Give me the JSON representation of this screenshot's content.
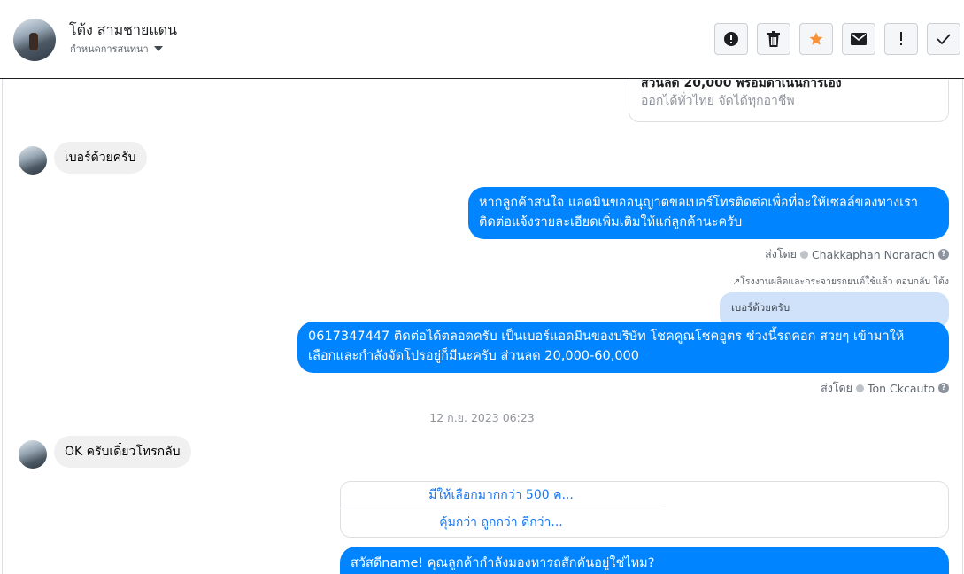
{
  "header": {
    "name": "โต้ง สามชายแดน",
    "subtitle": "กำหนดการสนทนา"
  },
  "toolbar": {
    "buttons": [
      "spam-alert-icon",
      "trash-icon",
      "star-icon",
      "envelope-icon",
      "exclamation-icon",
      "checkmark-icon"
    ],
    "star_color": "#f7923a"
  },
  "messages": {
    "top_card_line1": "ส่วนลด 20,000 พร้อมดำเนินการเอง",
    "top_card_line2": "ออกได้ทั่วไทย จัดได้ทุกอาชีพ",
    "in1": "เบอร์ด้วยครับ",
    "out1_line1": "หากลูกค้าสนใจ แอดมินขออนุญาตขอเบอร์โทรติดต่อเพื่อที่จะให้เซลล์ของทางเรา",
    "out1_line2": "ติดต่อแจ้งรายละเอียดเพิ่มเติมให้แก่ลูกค้านะครับ",
    "sent1_prefix": "ส่งโดย",
    "sent1_name": "Chakkaphan Norarach",
    "reply_note": "โรงงานผลิตและกระจายรถยนต์ใช้แล้ว ตอบกลับ โต้ง",
    "quoted": "เบอร์ด้วยครับ",
    "out2_line1": "0617347447 ติดต่อได้ตลอดครับ เป็นเบอร์แอดมินของบริษัท โชคคูณโชคอูตร ช่วงนี้รถคอก สวยๆ เข้ามาให้",
    "out2_line2": "เลือกและกำลังจัดโปรอยู่ก็มีนะครับ ส่วนลด 20,000-60,000",
    "sent2_prefix": "ส่งโดย",
    "sent2_name": "Ton Ckcauto",
    "timestamp": "12 ก.ย. 2023 06:23",
    "in2": "OK ครับเดี๋ยวโทรกลับ",
    "option1": "มีให้เลือกมากกว่า 500 ค...",
    "option2": "คุ้มกว่า ถูกกว่า ดีกว่า...",
    "out3": "สวัสดีname! คุณลูกค้ากำลังมองหารถสักคันอยู่ใช่ไหม?"
  },
  "colors": {
    "accent": "#0084ff",
    "incoming_bg": "#f0f0f0",
    "quoted_bg": "#cfe2fa",
    "link": "#1877f2"
  }
}
